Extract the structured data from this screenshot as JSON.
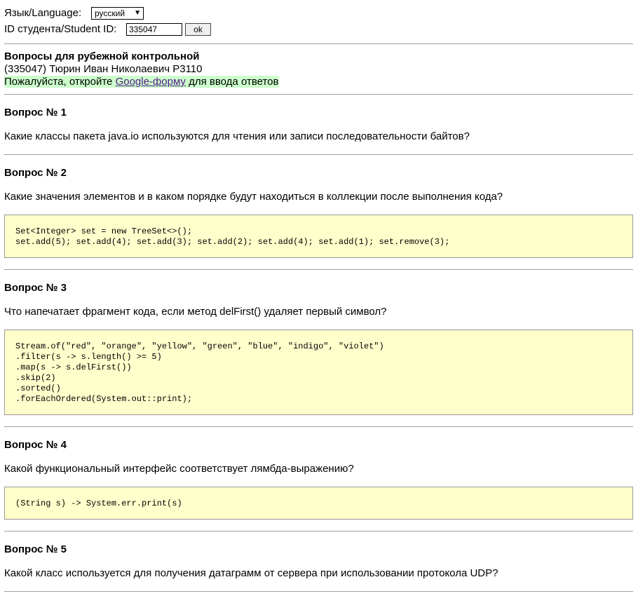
{
  "header": {
    "language_label": "Язык/Language:",
    "language_selected": "русский",
    "student_id_label": "ID студента/Student ID:",
    "student_id_value": "335047",
    "ok_button": "ok"
  },
  "info": {
    "title": "Вопросы для рубежной контрольной",
    "student": "(335047) Тюрин Иван Николаевич P3110",
    "form_prefix": "Пожалуйста, откройте ",
    "form_link": "Google-форму",
    "form_suffix": " для ввода ответов"
  },
  "questions": [
    {
      "title": "Вопрос № 1",
      "text": "Какие классы пакета java.io используются для чтения или записи последовательности байтов?"
    },
    {
      "title": "Вопрос № 2",
      "text": "Какие значения элементов и в каком порядке будут находиться в коллекции после выполнения кода?",
      "code": "Set<Integer> set = new TreeSet<>();\nset.add(5); set.add(4); set.add(3); set.add(2); set.add(4); set.add(1); set.remove(3);"
    },
    {
      "title": "Вопрос № 3",
      "text": "Что напечатает фрагмент кода, если метод delFirst() удаляет первый символ?",
      "code": "Stream.of(\"red\", \"orange\", \"yellow\", \"green\", \"blue\", \"indigo\", \"violet\")\n.filter(s -> s.length() >= 5)\n.map(s -> s.delFirst())\n.skip(2)\n.sorted()\n.forEachOrdered(System.out::print);"
    },
    {
      "title": "Вопрос № 4",
      "text": "Какой функциональный интерфейс соответствует лямбда-выражению?",
      "code": "(String s) -> System.err.print(s)"
    },
    {
      "title": "Вопрос № 5",
      "text": "Какой класс используется для получения датаграмм от сервера при использовании протокола UDP?"
    }
  ],
  "colors": {
    "code_background": "#ffffcc",
    "form_highlight": "#ccffcc",
    "link": "#551a8b"
  }
}
